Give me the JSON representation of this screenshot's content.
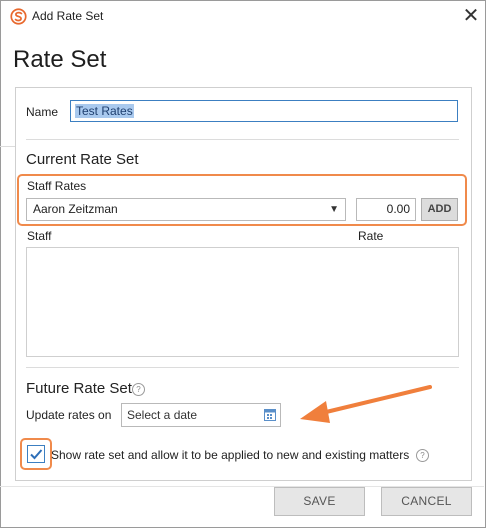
{
  "window": {
    "title": "Add Rate Set",
    "close_glyph": "✕",
    "app_icon": "sp-logo-icon"
  },
  "heading": "Rate Set",
  "name_field": {
    "label": "Name",
    "value": "Test Rates"
  },
  "current_rate_set": {
    "title": "Current Rate Set",
    "staff_rates_label": "Staff Rates",
    "staff_select_value": "Aaron Zeitzman",
    "rate_value": "0.00",
    "add_label": "ADD",
    "table_headers": [
      "Staff",
      "Rate"
    ],
    "rows": []
  },
  "future_rate_set": {
    "title": "Future Rate Set",
    "help_glyph": "?",
    "update_label": "Update rates on",
    "date_placeholder": "Select a date"
  },
  "show_checkbox": {
    "checked": true,
    "label": "Show rate set and allow it to be applied to new and existing matters",
    "help_glyph": "?"
  },
  "footer": {
    "save_label": "SAVE",
    "cancel_label": "CANCEL"
  },
  "colors": {
    "highlight_orange": "#f08a4b",
    "focus_blue": "#3c7fc1",
    "selection_blue": "#a9c9ee",
    "button_gray": "#e6e6e6"
  }
}
